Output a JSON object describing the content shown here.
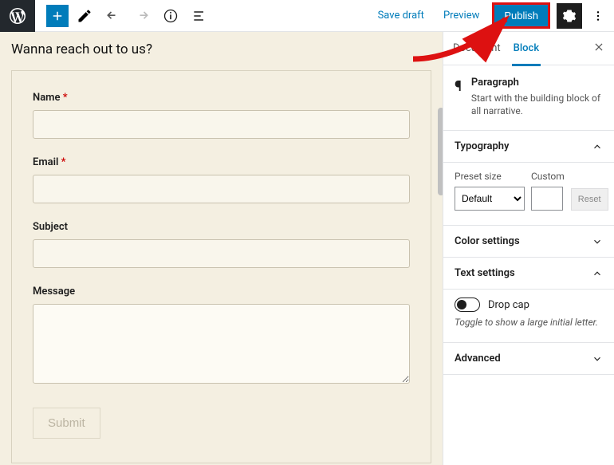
{
  "toolbar": {
    "save_draft": "Save draft",
    "preview": "Preview",
    "publish": "Publish"
  },
  "canvas": {
    "heading": "Wanna reach out to us?",
    "form": {
      "name_label": "Name",
      "email_label": "Email",
      "subject_label": "Subject",
      "message_label": "Message",
      "submit_label": "Submit",
      "required_marker": "*"
    }
  },
  "sidebar": {
    "tabs": {
      "document": "Document",
      "block": "Block"
    },
    "block_info": {
      "title": "Paragraph",
      "desc": "Start with the building block of all narrative."
    },
    "panels": {
      "typography": {
        "title": "Typography",
        "preset_label": "Preset size",
        "preset_value": "Default",
        "custom_label": "Custom",
        "reset": "Reset"
      },
      "color": {
        "title": "Color settings"
      },
      "text": {
        "title": "Text settings",
        "dropcap_label": "Drop cap",
        "dropcap_help": "Toggle to show a large initial letter."
      },
      "advanced": {
        "title": "Advanced"
      }
    }
  }
}
